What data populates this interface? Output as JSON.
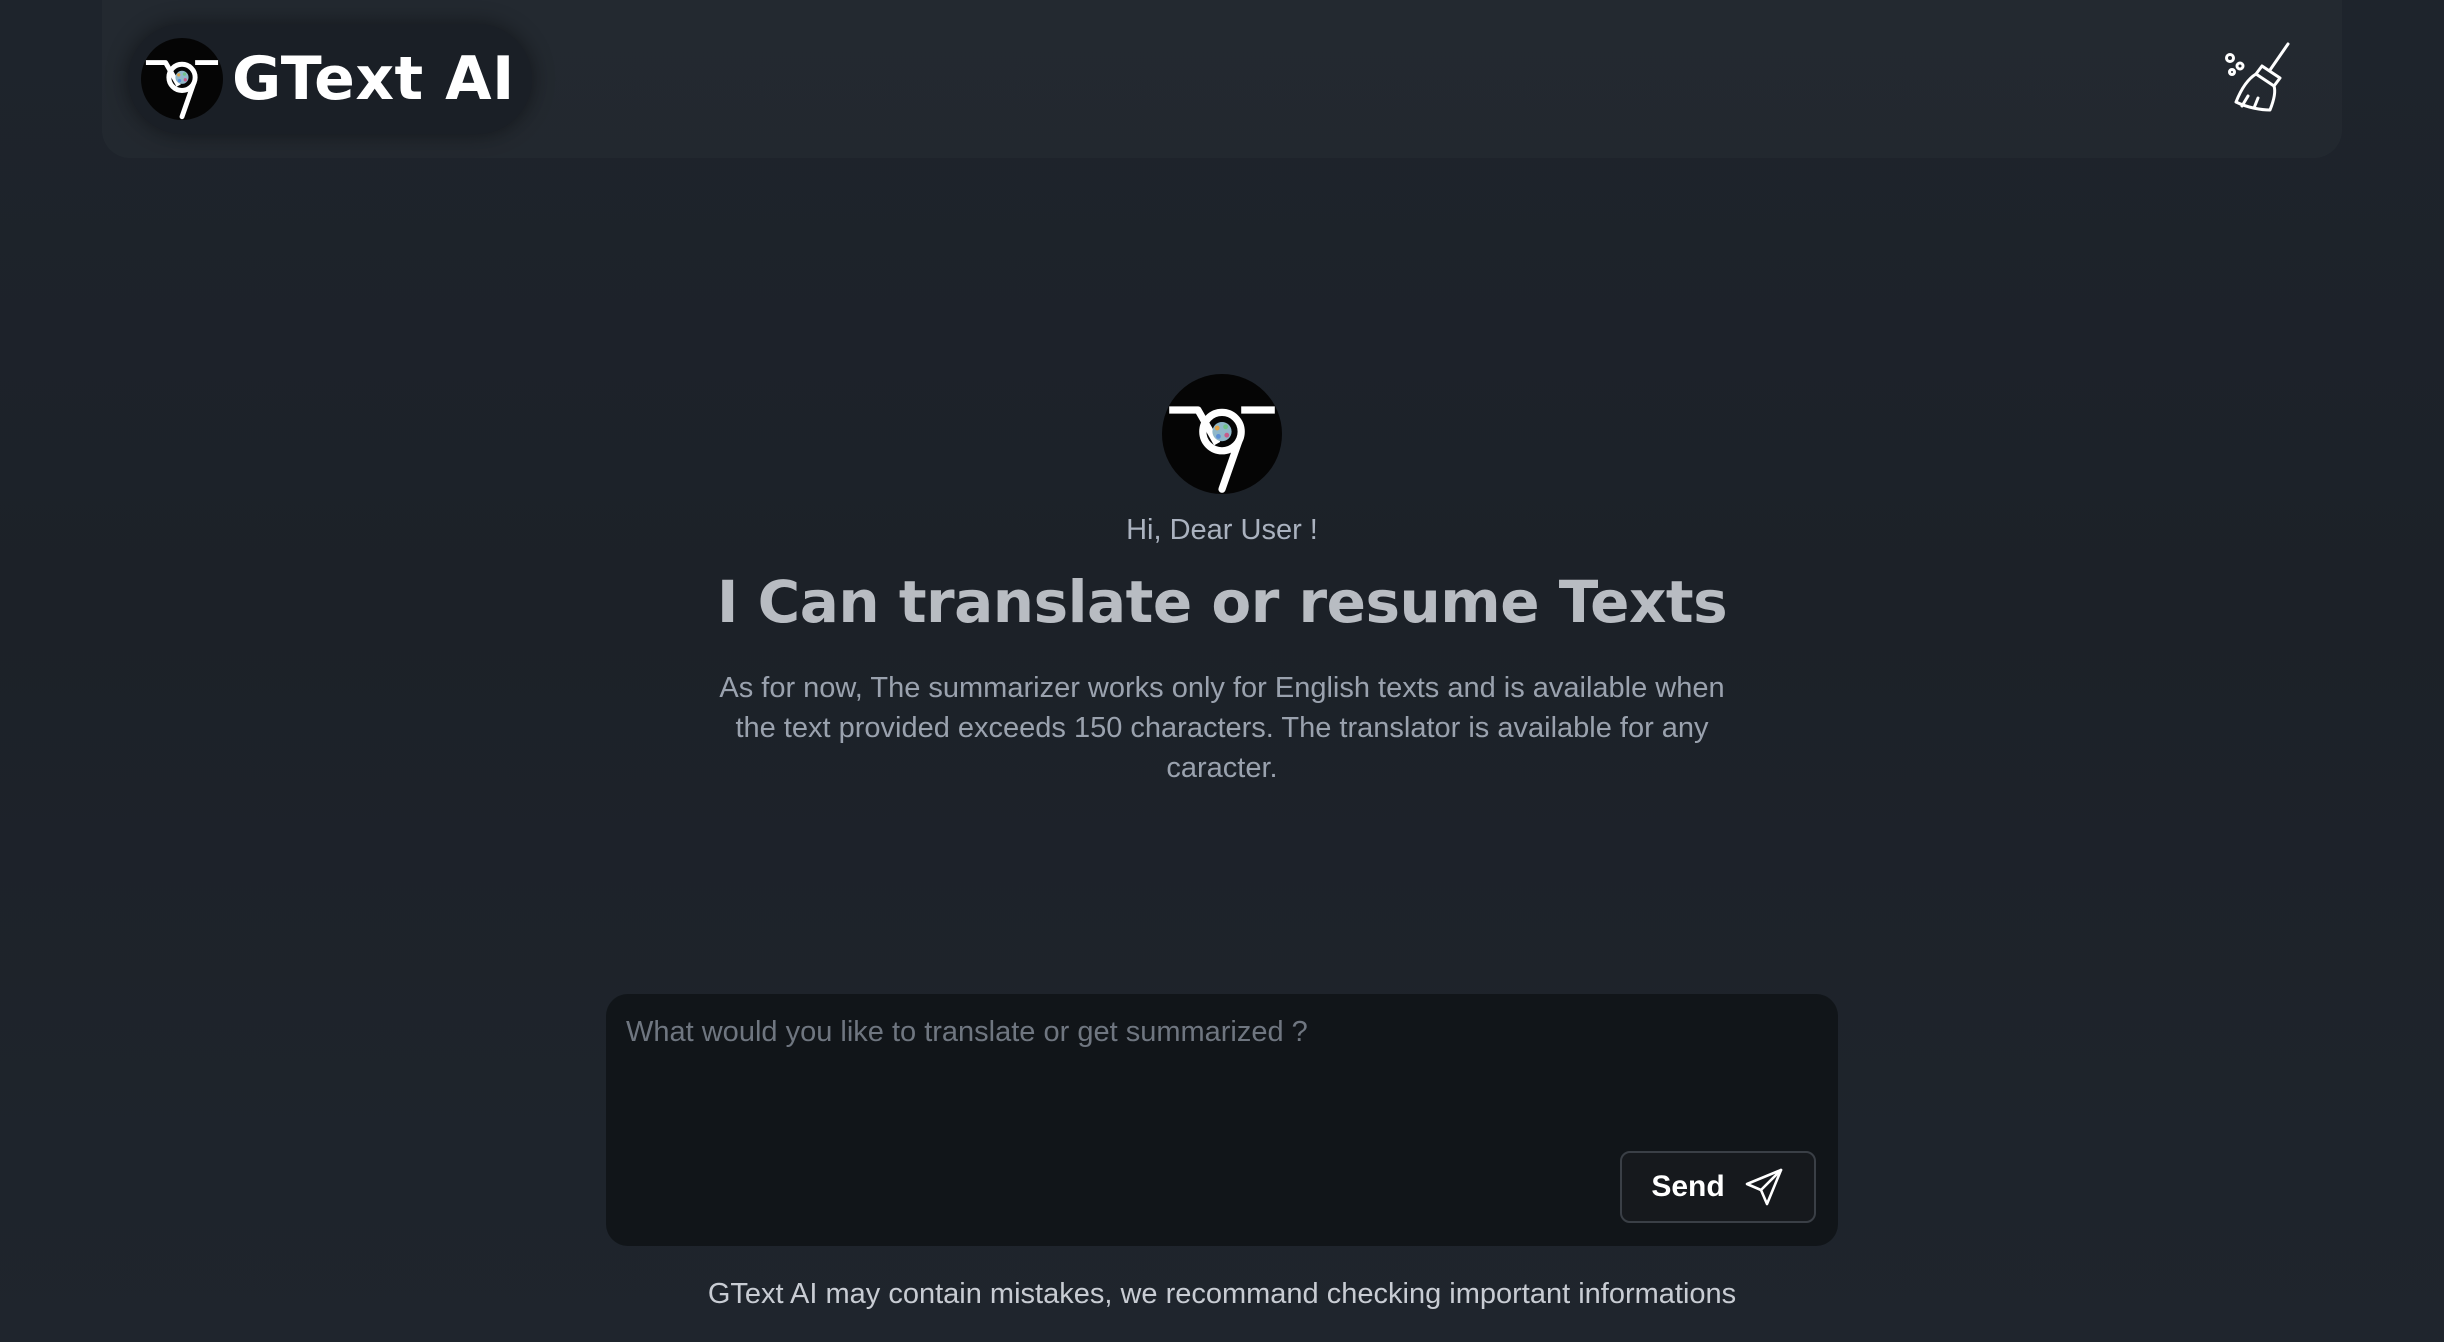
{
  "header": {
    "app_title": "GText AI",
    "logo_icon": "chrome-style-nine-logo",
    "clear_icon": "broom-icon"
  },
  "hero": {
    "logo_icon": "chrome-style-nine-logo",
    "greeting": "Hi, Dear User !",
    "headline": "I Can translate or resume Texts",
    "description": "As for now, The summarizer works only for English texts and is available when the text provided exceeds 150 characters. The translator is available for any caracter."
  },
  "composer": {
    "placeholder": "What would you like to translate or get summarized ?",
    "value": "",
    "send_label": "Send",
    "send_icon": "paper-plane-icon"
  },
  "footer": {
    "disclaimer": "GText AI may contain mistakes, we recommand checking important informations"
  },
  "colors": {
    "background": "#1e242c",
    "composer_bg": "#111519",
    "text_primary": "#ffffff",
    "text_muted": "#9aa2ae"
  }
}
